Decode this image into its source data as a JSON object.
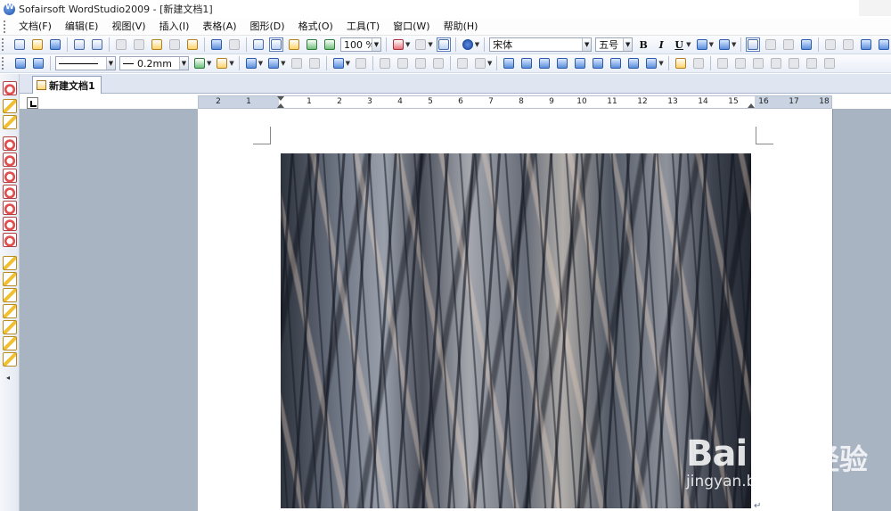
{
  "window": {
    "title": "Sofairsoft WordStudio2009 - [新建文档1]"
  },
  "menu": [
    "文档(F)",
    "编辑(E)",
    "视图(V)",
    "插入(I)",
    "表格(A)",
    "图形(D)",
    "格式(O)",
    "工具(T)",
    "窗口(W)",
    "帮助(H)"
  ],
  "toolbar1": {
    "zoom": "100 %",
    "font_name": "宋体",
    "font_size": "五号",
    "bold": "B",
    "italic": "I",
    "underline": "U"
  },
  "toolbar2": {
    "line_width": "0.2mm"
  },
  "tabs": {
    "document_tab": "新建文档1"
  },
  "ruler": {
    "labels": [
      "2",
      "1",
      "1",
      "2",
      "3",
      "4",
      "5",
      "6",
      "7",
      "8",
      "9",
      "10",
      "11",
      "12",
      "13",
      "14",
      "15",
      "16",
      "17",
      "18"
    ]
  },
  "document": {
    "paragraph_mark": "↵"
  },
  "watermark": {
    "brand": "Bai",
    "brand_cn": "经验",
    "url": "jingyan.baidu.com"
  }
}
